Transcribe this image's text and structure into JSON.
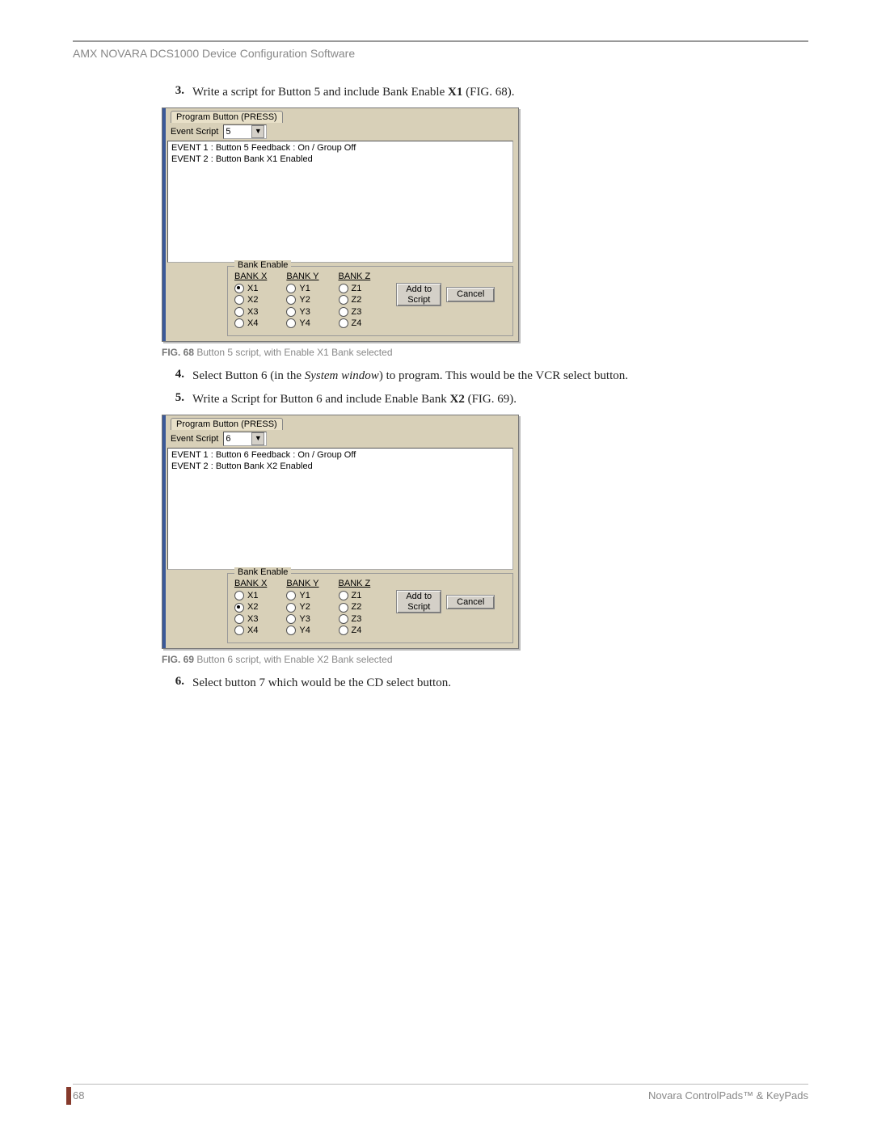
{
  "header": {
    "title": "AMX NOVARA DCS1000 Device Configuration Software"
  },
  "footer": {
    "page_num": "68",
    "product_line": "Novara ControlPads™ & KeyPads"
  },
  "steps": {
    "s3": {
      "num": "3.",
      "pre": "Write a script for Button 5 and include Bank Enable ",
      "bold": "X1",
      "post": " (FIG. 68)."
    },
    "s4": {
      "num": "4.",
      "pre": "Select Button 6 (in the ",
      "italic": "System window",
      "post": ") to program. This would be the VCR select button."
    },
    "s5": {
      "num": "5.",
      "pre": "Write a Script for Button 6 and include Enable Bank ",
      "bold": "X2",
      "post": " (FIG. 69)."
    },
    "s6": {
      "num": "6.",
      "text": "Select button 7 which would be the CD select button."
    }
  },
  "captions": {
    "fig68": {
      "label": "FIG. 68",
      "text": " Button 5 script, with Enable X1 Bank selected"
    },
    "fig69": {
      "label": "FIG. 69",
      "text": " Button 6 script, with Enable X2 Bank selected"
    }
  },
  "win": {
    "tab_label": "Program Button (PRESS)",
    "event_script_label": "Event Script",
    "bank_enable_label": "Bank Enable",
    "headers": {
      "x": "BANK X",
      "y": "BANK Y",
      "z": "BANK Z"
    },
    "opts": {
      "x": [
        "X1",
        "X2",
        "X3",
        "X4"
      ],
      "y": [
        "Y1",
        "Y2",
        "Y3",
        "Y4"
      ],
      "z": [
        "Z1",
        "Z2",
        "Z3",
        "Z4"
      ]
    },
    "add_btn": "Add to\nScript",
    "cancel_btn": "Cancel"
  },
  "fig68box": {
    "combo_value": "5",
    "event1": "EVENT 1  : Button 5 Feedback : On / Group Off",
    "event2": "EVENT 2  : Button Bank X1 Enabled",
    "selected_radio": "X1"
  },
  "fig69box": {
    "combo_value": "6",
    "event1": "EVENT 1  : Button 6 Feedback : On / Group Off",
    "event2": "EVENT 2  : Button Bank X2 Enabled",
    "selected_radio": "X2"
  }
}
